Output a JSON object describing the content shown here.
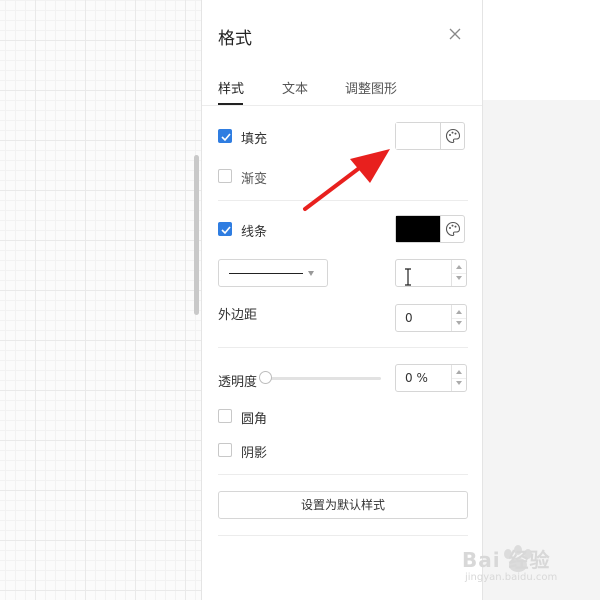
{
  "panel": {
    "title": "格式",
    "tabs": [
      {
        "label": "样式",
        "active": true
      },
      {
        "label": "文本",
        "active": false
      },
      {
        "label": "调整图形",
        "active": false
      }
    ]
  },
  "style": {
    "fill": {
      "label": "填充",
      "checked": true,
      "color": "#ffffff"
    },
    "gradient": {
      "label": "渐变",
      "checked": false
    },
    "stroke": {
      "label": "线条",
      "checked": true,
      "color": "#000000"
    },
    "line_width": {
      "value": ""
    },
    "margin": {
      "label": "外边距",
      "value": "0"
    },
    "opacity": {
      "label": "透明度",
      "value": "0 %",
      "level_percent": 0
    },
    "rounded": {
      "label": "圆角",
      "checked": false
    },
    "shadow": {
      "label": "阴影",
      "checked": false
    },
    "default_button": "设置为默认样式"
  },
  "colors": {
    "accent": "#2f7de1",
    "annotation_arrow": "#e8201e"
  },
  "watermark": {
    "text": "Bai 经验",
    "url": "jingyan.baidu.com"
  }
}
